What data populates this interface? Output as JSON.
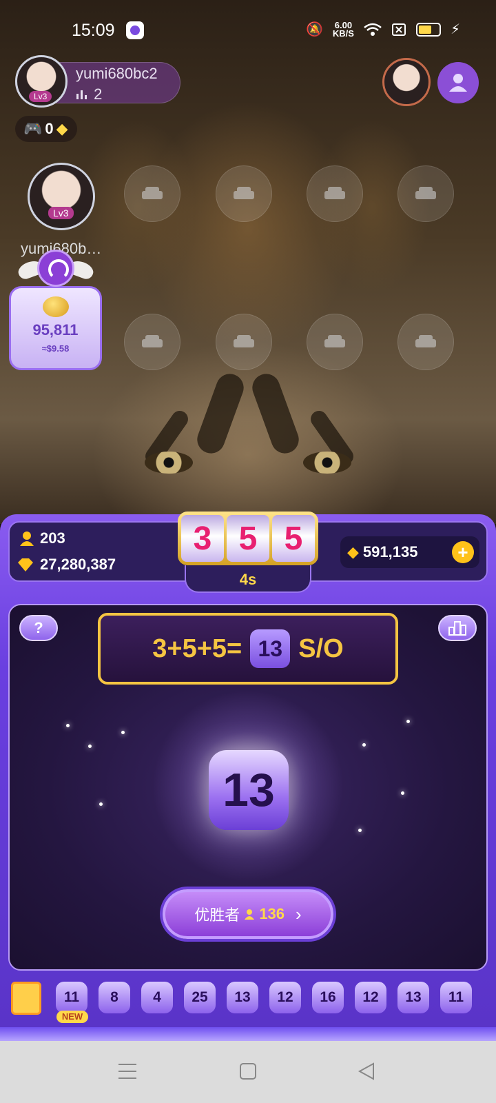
{
  "status_bar": {
    "time": "15:09",
    "net_speed": "6.00",
    "net_unit": "KB/S"
  },
  "host": {
    "name": "yumi680bc2",
    "level": "Lv3",
    "viewers": "2"
  },
  "game_badge": {
    "count": "0"
  },
  "seats": {
    "main_name": "yumi680b…",
    "main_level": "Lv3"
  },
  "gift": {
    "amount": "95,811",
    "usd": "≈$9.58"
  },
  "game": {
    "players": "203",
    "pool": "27,280,387",
    "reels": [
      "3",
      "5",
      "5"
    ],
    "timer": "4s",
    "balance": "591,135",
    "help_label": "?",
    "formula": "3+5+5=",
    "formula_result": "13",
    "formula_suffix": "S/O",
    "result": "13",
    "winner_label": "优胜者",
    "winner_count": "136",
    "history": [
      "11",
      "8",
      "4",
      "25",
      "13",
      "12",
      "16",
      "12",
      "13",
      "11"
    ],
    "new_tag": "NEW"
  },
  "colors": {
    "accent": "#6a3fe0",
    "gold": "#f5c542",
    "reel_digit": "#e82070"
  }
}
